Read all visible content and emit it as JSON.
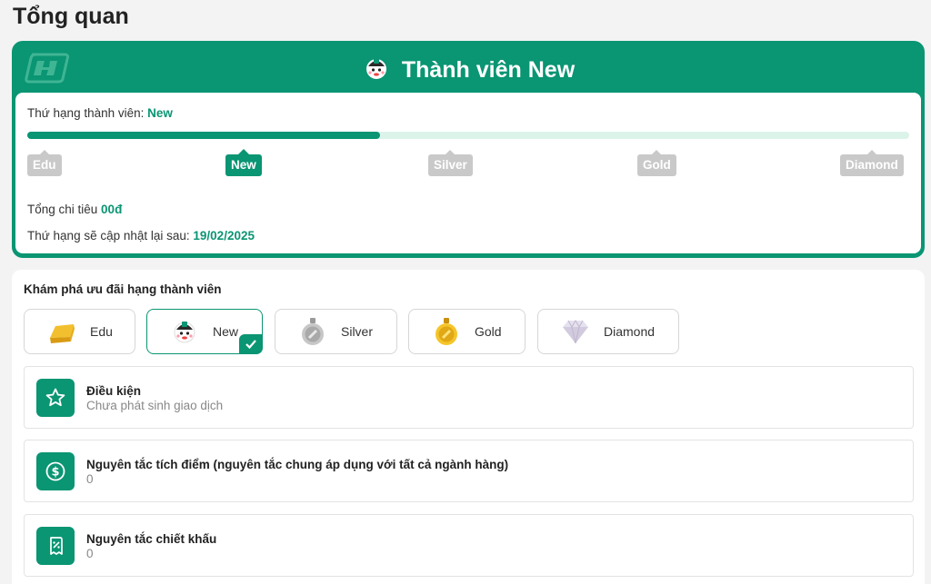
{
  "page": {
    "title": "Tổng quan"
  },
  "membership": {
    "header_title": "Thành viên New",
    "rank_label": "Thứ hạng thành viên: ",
    "rank_value": "New",
    "progress_fraction": 0.4,
    "tiers": [
      {
        "label": "Edu",
        "active": false
      },
      {
        "label": "New",
        "active": true
      },
      {
        "label": "Silver",
        "active": false
      },
      {
        "label": "Gold",
        "active": false
      },
      {
        "label": "Diamond",
        "active": false
      }
    ],
    "spend_label": "Tổng chi tiêu ",
    "spend_value": "00đ",
    "update_label": "Thứ hạng sẽ cập nhật lại sau: ",
    "update_value": "19/02/2025"
  },
  "benefits": {
    "title": "Khám phá ưu đãi hạng thành viên",
    "tabs": [
      {
        "label": "Edu",
        "icon": "gold-bar-icon"
      },
      {
        "label": "New",
        "icon": "mascot-icon",
        "selected": true
      },
      {
        "label": "Silver",
        "icon": "silver-medal-icon"
      },
      {
        "label": "Gold",
        "icon": "gold-medal-icon"
      },
      {
        "label": "Diamond",
        "icon": "diamond-icon"
      }
    ],
    "rows": [
      {
        "title": "Điều kiện",
        "value": "Chưa phát sinh giao dịch",
        "icon": "star-icon"
      },
      {
        "title": "Nguyên tắc tích điểm (nguyên tắc chung áp dụng với tất cả ngành hàng)",
        "value": "0",
        "icon": "dollar-coin-icon"
      },
      {
        "title": "Nguyên tắc chiết khấu",
        "value": "0",
        "icon": "discount-receipt-icon"
      }
    ]
  },
  "colors": {
    "brand": "#0a9573",
    "track": "#dcf3ea",
    "chip_inactive": "#c9c9c9"
  }
}
